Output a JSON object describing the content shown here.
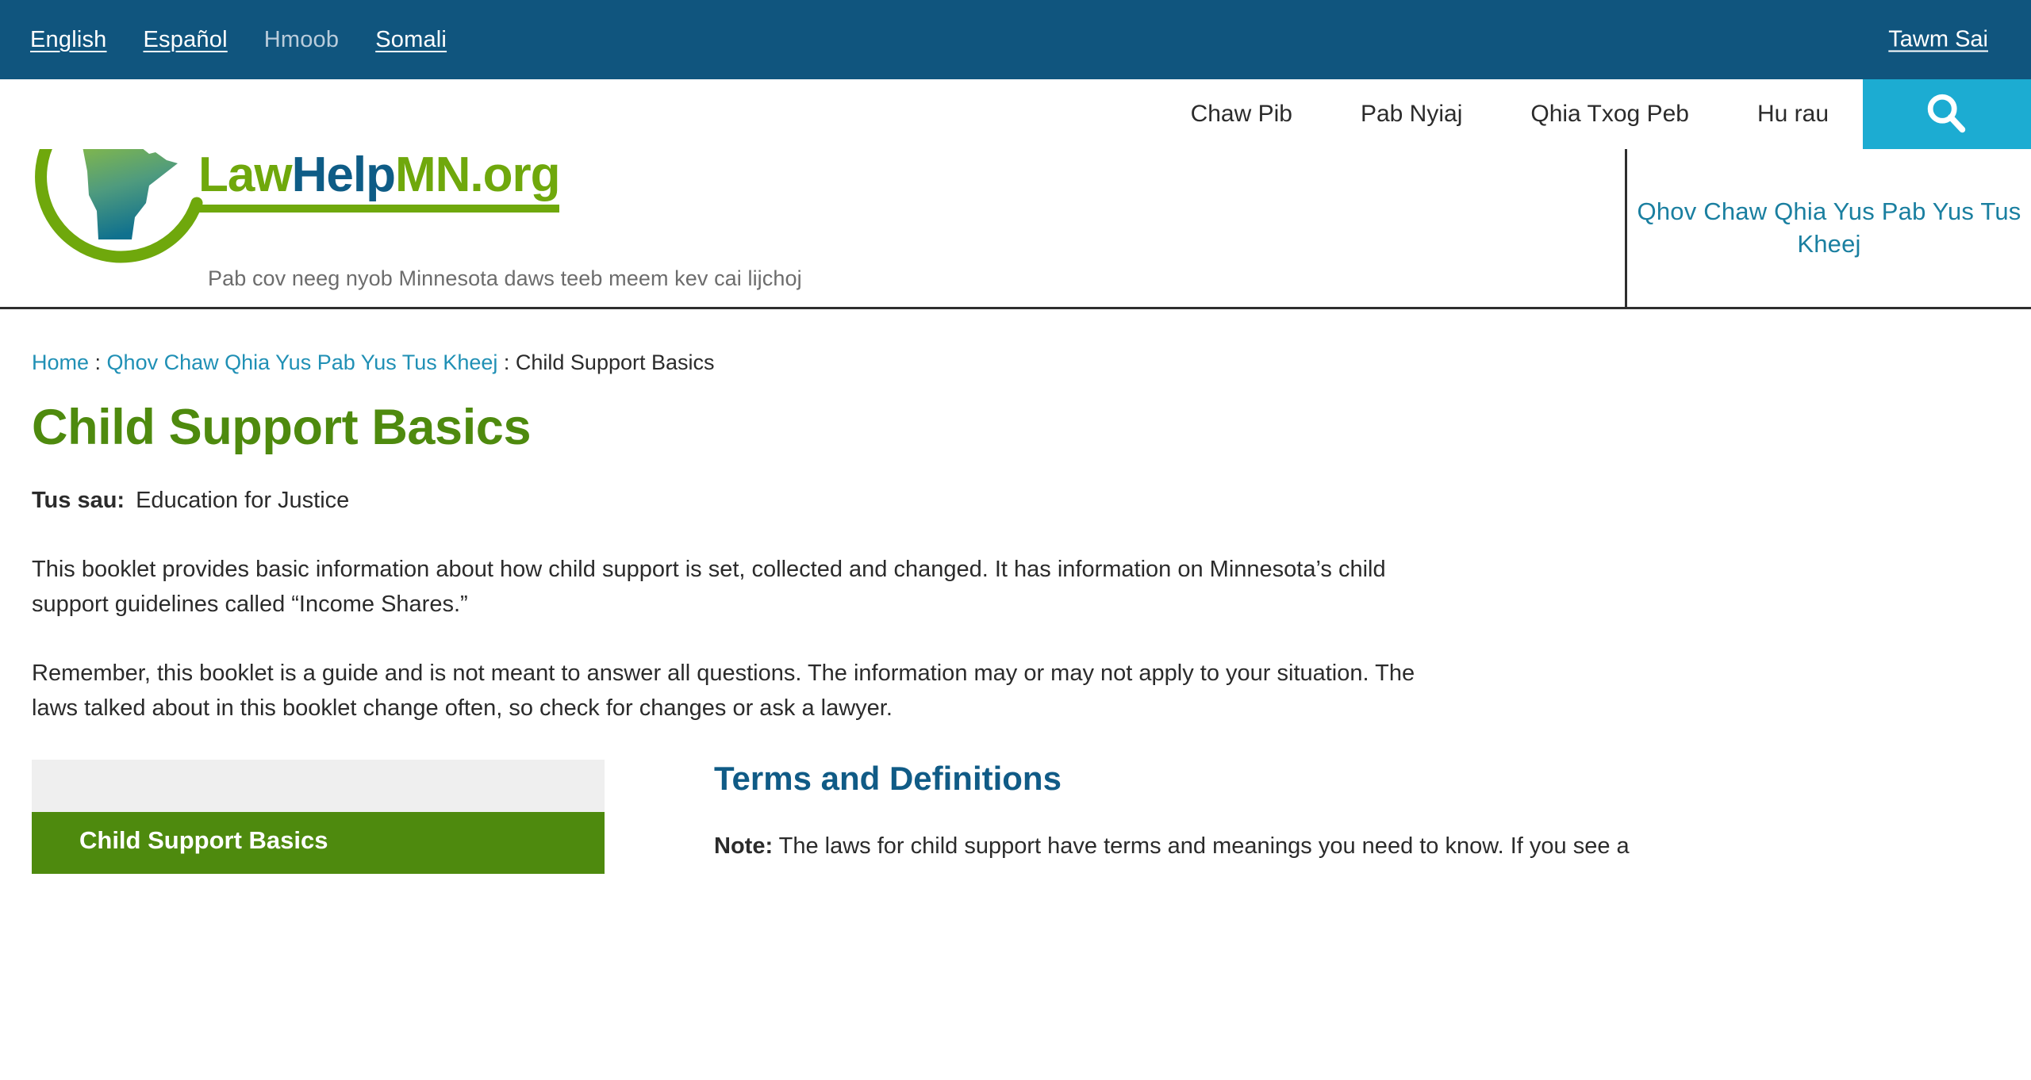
{
  "colors": {
    "topbar_bg": "#10557E",
    "search_bg": "#1CACD2",
    "brand_green": "#4E8A0E",
    "brand_blue": "#105B86",
    "link_teal": "#2090B5",
    "selfhelp_teal": "#1A7FA0",
    "card_gray": "#EFEFEF"
  },
  "topbar": {
    "languages": [
      {
        "label": "English",
        "active": false
      },
      {
        "label": "Español",
        "active": false
      },
      {
        "label": "Hmoob",
        "active": true
      },
      {
        "label": "Somali",
        "active": false
      }
    ],
    "exit_label": "Tawm Sai"
  },
  "nav": {
    "items": [
      {
        "label": "Chaw Pib"
      },
      {
        "label": "Pab Nyiaj"
      },
      {
        "label": "Qhia Txog Peb"
      },
      {
        "label": "Hu rau"
      }
    ],
    "search_icon": "search-icon"
  },
  "brand": {
    "logo_icon": "lawhelpmn-logo-icon",
    "name_part1": "Law",
    "name_part2": "Help",
    "name_part3": "MN.org",
    "tagline": "Pab cov neeg nyob Minnesota daws teeb meem kev cai lijchoj",
    "selfhelp_label": "Qhov Chaw Qhia Yus Pab Yus Tus Kheej"
  },
  "breadcrumb": {
    "home": "Home",
    "sep1": " : ",
    "section": "Qhov Chaw Qhia Yus Pab Yus Tus Kheej",
    "sep2": " : ",
    "current": "Child Support Basics"
  },
  "page": {
    "title": "Child Support Basics",
    "author_label": "Tus sau:",
    "author_name": "Education for Justice",
    "paragraph1": "This booklet provides basic information about how child support is set, collected and changed.  It has information on Minnesota’s child support guidelines called “Income Shares.”",
    "paragraph2": "Remember, this booklet is a guide and is not meant to answer all questions. The information may or may not apply to your situation.  The laws talked about in this booklet change often, so check for changes or ask a lawyer."
  },
  "booklet_card": {
    "title": "Child Support Basics"
  },
  "terms_section": {
    "heading": "Terms and Definitions",
    "note_label": "Note:",
    "note_text": " The laws for child support have terms and meanings you need to know.  If you see a"
  }
}
